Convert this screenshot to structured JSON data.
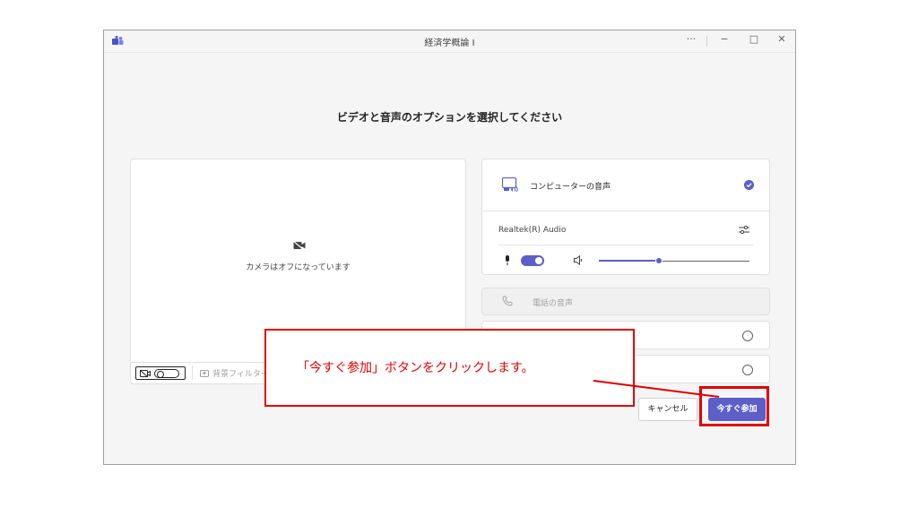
{
  "window": {
    "title": "経済学概論 I",
    "more_label": "···",
    "minimize_label": "−",
    "maximize_label": "□",
    "close_label": "✕"
  },
  "heading": "ビデオと音声のオプションを選択してください",
  "video": {
    "camera_off_text": "カメラはオフになっています",
    "background_filter_label": "背景フィルター"
  },
  "audio": {
    "computer_audio_label": "コンピューターの音声",
    "device_name": "Realtek(R) Audio",
    "mic_on": true,
    "speaker_volume": 0.4
  },
  "phone_audio_label": "電話の音声",
  "buttons": {
    "cancel": "キャンセル",
    "join_now": "今すぐ参加"
  },
  "annotation": {
    "callout_text": "「今すぐ参加」ボタンをクリックします。"
  },
  "colors": {
    "accent": "#5b5fc7",
    "annotation_red": "#e00000"
  },
  "icons": {
    "app": "teams-icon",
    "camera_off": "camera-off-icon",
    "computer_audio": "computer-audio-icon",
    "selected": "check-circle-icon",
    "settings": "audio-settings-icon",
    "mic": "mic-icon",
    "speaker": "speaker-icon",
    "phone": "phone-icon",
    "background": "background-effects-icon"
  }
}
